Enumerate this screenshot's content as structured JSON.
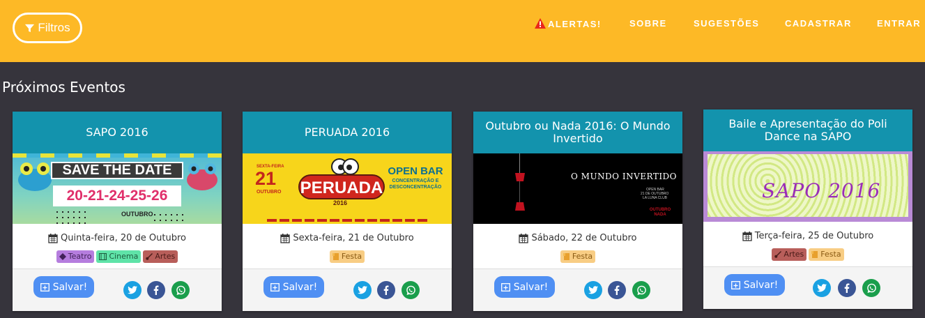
{
  "nav": {
    "filter_label": "Filtros",
    "alerts": "ALERTAS!",
    "about": "SOBRE",
    "suggestions": "SUGESTÕES",
    "register": "CADASTRAR",
    "login": "ENTRAR"
  },
  "section_title": "Próximos Eventos",
  "save_label": "Salvar!",
  "events": [
    {
      "title": "SAPO 2016",
      "date": "Quinta-feira, 20 de Outubro",
      "tags": [
        "Teatro",
        "Cinema",
        "Artes"
      ],
      "image_text": {
        "line1": "SAVE THE DATE",
        "line2": "20-21-24-25-26",
        "line3": "OUTUBRO"
      }
    },
    {
      "title": "PERUADA 2016",
      "date": "Sexta-feira, 21 de Outubro",
      "tags": [
        "Festa"
      ],
      "image_text": {
        "day_name": "SEXTA-FEIRA",
        "day": "21",
        "month": "OUTUBRO",
        "name": "PERUADA",
        "year": "2016",
        "open_bar": "OPEN BAR",
        "sub": "CONCENTRAÇÃO E DESCONCENTRAÇÃO"
      }
    },
    {
      "title": "Outubro ou Nada 2016: O Mundo Invertido",
      "date": "Sábado, 22 de Outubro",
      "tags": [
        "Festa"
      ],
      "image_text": {
        "headline": "O MUNDO INVERTIDO",
        "detail1": "OPEN BAR",
        "detail2": "21 DE OUTUBRO",
        "detail3": "LA LUNA CLUB",
        "brand": "OUTUBRO NADA"
      }
    },
    {
      "title": "Baile e Apresentação do Poli Dance na SAPO",
      "date": "Terça-feira, 25 de Outubro",
      "tags": [
        "Artes",
        "Festa"
      ],
      "image_text": {
        "headline": "SAPO 2016"
      }
    }
  ],
  "colors": {
    "navbar": "#fdb926",
    "background": "#36343c",
    "card_header": "#1393ad",
    "save_button": "#4f8ff3",
    "twitter": "#1aa1e2",
    "facebook": "#3a5595",
    "whatsapp": "#1a9e4c"
  }
}
